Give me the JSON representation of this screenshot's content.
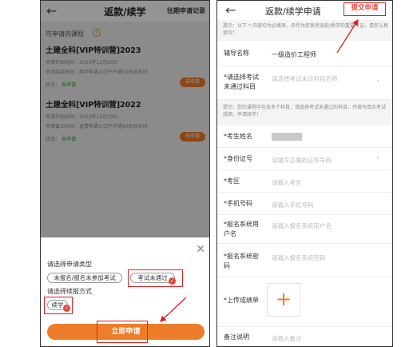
{
  "left": {
    "header": {
      "back_icon": "back-arrow-icon",
      "title": "返款/续学",
      "records": "往期申请记录"
    },
    "courses_title": "可申请的课程",
    "help_icon": "?",
    "courses": [
      {
        "name": "土建全科[VIP特训营]2023",
        "start": "申请开始时间：2023年12月29日",
        "end": "申请结束时间：续学申请入口于开通30天后关闭",
        "status_label": "状态：",
        "status": "未申请",
        "button": "去申请"
      },
      {
        "name": "土建全科[VIP特训营]2022",
        "start": "申请开始时间：2023年12月29日",
        "end": "申请截止时间：返费申请入口于开通30天后关闭",
        "status_label": "状态：",
        "status": "未申请",
        "button": "去申请"
      }
    ],
    "sheet": {
      "close": "✕",
      "type_label": "请选择申请类型",
      "type_options": [
        "未报名/报名未参加考试",
        "考试未通过"
      ],
      "type_selected": "考试未通过",
      "method_label": "请选择续报方式",
      "method_options": [
        "续学"
      ],
      "method_selected": "续学",
      "check_mark": "✓",
      "apply_button": "立即申请"
    }
  },
  "right": {
    "header": {
      "back_icon": "back-arrow-icon",
      "title": "返款/续学申请",
      "submit": "提交申请"
    },
    "tip1": "提示：以下 * 内容均为必填项，且作为您享受返款/续学的重要凭证，请您认真填写！",
    "tip2": "提示：您的课程中包含多个科目，请选择考试未通过的科目，并填写真实考试成绩，申请续学！",
    "fields": {
      "tutor": {
        "label": "辅导名称",
        "value": "一级造价工程师"
      },
      "subject": {
        "label": "*请选择考试未通过科目",
        "placeholder": "请选择考试未过科目名称"
      },
      "name": {
        "label": "*考生姓名"
      },
      "id": {
        "label": "*身份证号",
        "placeholder": "请填写正确的证件号码"
      },
      "region": {
        "label": "*考区",
        "placeholder": "请输入考区"
      },
      "phone": {
        "label": "*手机号码",
        "placeholder": "请输入手机号码"
      },
      "reg_user": {
        "label": "*报名系统用户名",
        "placeholder": "请输入报名系统用户名"
      },
      "reg_pwd": {
        "label": "*报名系统密码",
        "placeholder": "请输入报名系统密码"
      },
      "upload": {
        "label": "*上传成绩单",
        "plus": "+"
      },
      "note": {
        "label": "备注说明",
        "placeholder": "请输入备注"
      }
    },
    "arrow": "›"
  },
  "colors": {
    "accent": "#ee7d2a",
    "annotation": "#e02020",
    "status_green": "#2d9a2d"
  }
}
